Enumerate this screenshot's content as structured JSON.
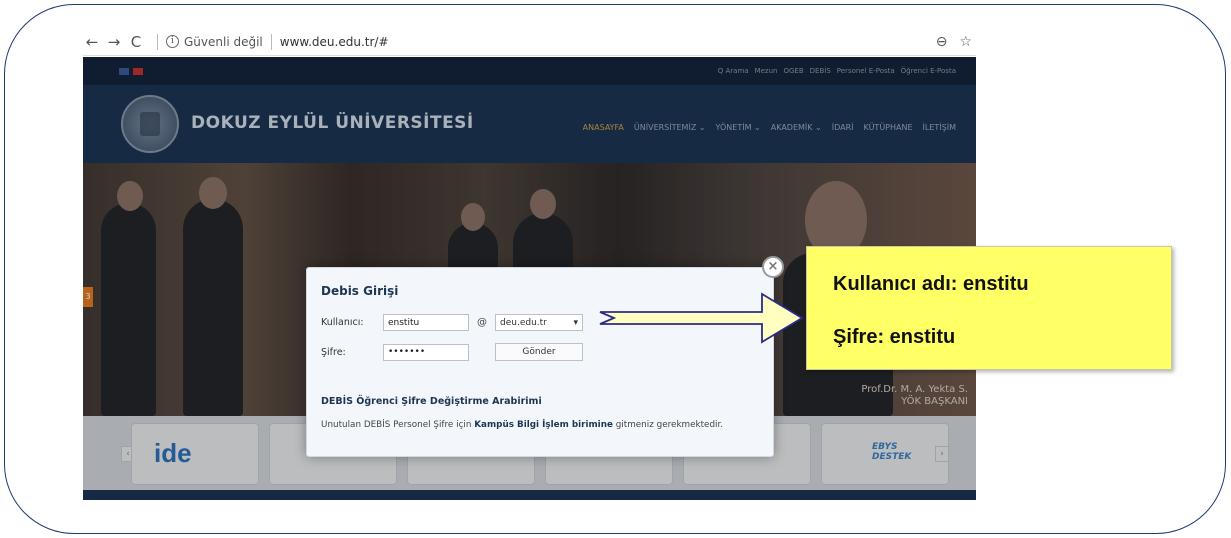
{
  "browser": {
    "back": "←",
    "forward": "→",
    "reload": "C",
    "info_icon": "i",
    "security_text": "Güvenli değil",
    "url": "www.deu.edu.tr/#",
    "zoom_icon": "⊖",
    "star_icon": "☆"
  },
  "site": {
    "top_links": [
      "Q Arama",
      "Mezun",
      "OGEB",
      "DEBİS",
      "Personel E-Posta",
      "Öğrenci E-Posta"
    ],
    "name": "DOKUZ EYLÜL ÜNİVERSİTESİ",
    "nav": [
      "ANASAYFA",
      "ÜNİVERSİTEMİZ ⌄",
      "YÖNETİM ⌄",
      "AKADEMİK ⌄",
      "İDARİ",
      "KÜTÜPHANE",
      "İLETİŞİM"
    ],
    "banner_caption_1": "Prof.Dr. M. A. Yekta S.",
    "banner_caption_2": "YÖK BAŞKANI",
    "banner_tab": "3",
    "ide_logo": "ide",
    "ebys_logo_1": "EBYS",
    "ebys_logo_2": "DESTEK",
    "arrow_prev": "‹",
    "arrow_next": "›"
  },
  "modal": {
    "title": "Debis Girişi",
    "username_label": "Kullanıcı:",
    "username_value": "enstitu",
    "at_sign": "@",
    "domain_value": "deu.edu.tr",
    "domain_caret": "▾",
    "password_label": "Şifre:",
    "password_value": "•••••••",
    "submit_label": "Gönder",
    "reset_link": "DEBİS Öğrenci Şifre Değiştirme Arabirimi",
    "note_prefix": "Unutulan DEBİS Personel Şifre için ",
    "note_bold": "Kampüs Bilgi İşlem birimine",
    "note_suffix": " gitmeniz gerekmektedir.",
    "close_icon": "×"
  },
  "callout": {
    "line1": "Kullanıcı adı: enstitu",
    "line2": "Şifre: enstitu"
  }
}
